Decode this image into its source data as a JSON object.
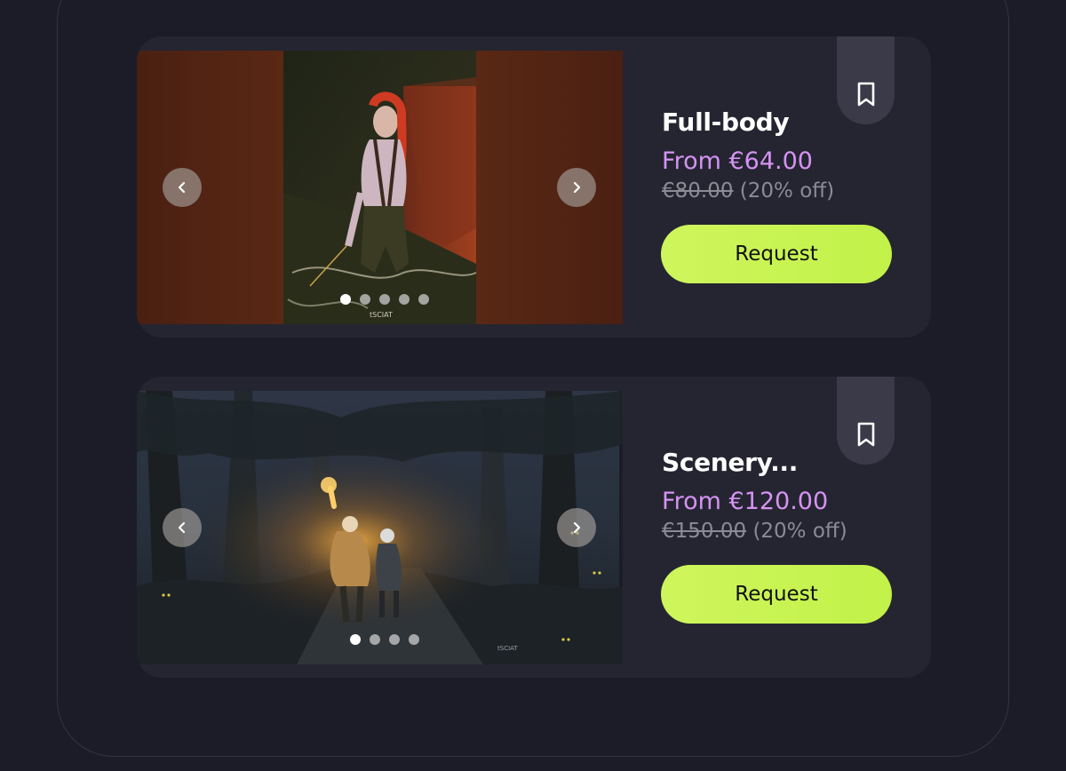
{
  "products": [
    {
      "title": "Full-body",
      "price": "From €64.00",
      "original_price": "€80.00",
      "discount": "(20% off)",
      "cta_label": "Request",
      "carousel_total": 5,
      "carousel_active": 1,
      "image_signature": "tSCIAT",
      "icons": {
        "bookmark": "bookmark-icon",
        "prev": "chevron-left-icon",
        "next": "chevron-right-icon"
      }
    },
    {
      "title": "Scenery...",
      "price": "From €120.00",
      "original_price": "€150.00",
      "discount": "(20% off)",
      "cta_label": "Request",
      "carousel_total": 4,
      "carousel_active": 1,
      "image_signature": "tSCIAT",
      "icons": {
        "bookmark": "bookmark-icon",
        "prev": "chevron-left-icon",
        "next": "chevron-right-icon"
      }
    }
  ],
  "colors": {
    "background": "#1c1c28",
    "card": "#252532",
    "price_accent": "#d593f2",
    "cta": "#c8f452",
    "muted_text": "#8b8b96"
  }
}
